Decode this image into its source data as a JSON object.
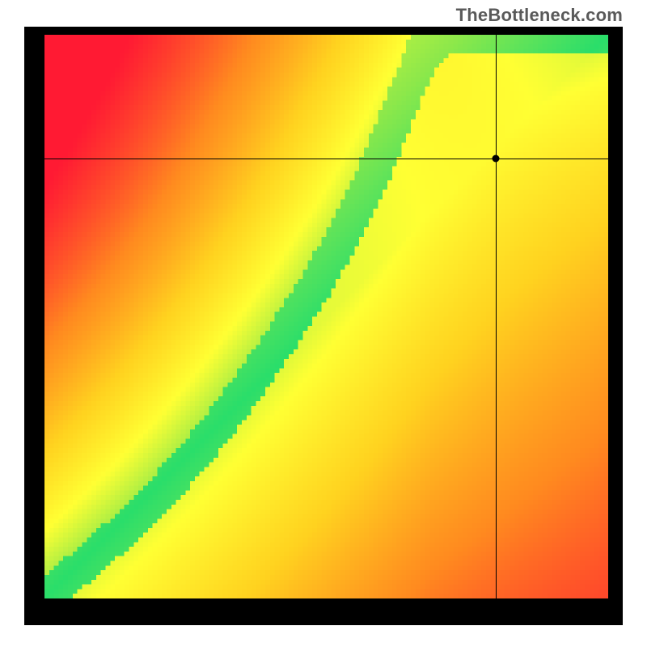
{
  "watermark": "TheBottleneck.com",
  "chart_data": {
    "type": "heatmap",
    "title": "",
    "xlabel": "",
    "ylabel": "",
    "xlim": [
      0,
      1
    ],
    "ylim": [
      0,
      1
    ],
    "grid": false,
    "legend": false,
    "colormap": [
      "#ff1a33",
      "#ff8a1f",
      "#ffd21f",
      "#ffff33",
      "#8de84a",
      "#00d978"
    ],
    "optimal_curve": {
      "name": "optimal-balance-band",
      "x": [
        0.0,
        0.07,
        0.14,
        0.21,
        0.28,
        0.35,
        0.42,
        0.49,
        0.56,
        0.6,
        0.63,
        0.66,
        0.68
      ],
      "y": [
        0.0,
        0.06,
        0.12,
        0.19,
        0.27,
        0.36,
        0.46,
        0.57,
        0.7,
        0.79,
        0.87,
        0.94,
        1.0
      ],
      "band_halfwidth": 0.05
    },
    "crosshair": {
      "x": 0.8,
      "y": 0.78
    },
    "marker": {
      "x": 0.8,
      "y": 0.78
    }
  },
  "render": {
    "canvas_size": 120,
    "display_size": 697
  }
}
